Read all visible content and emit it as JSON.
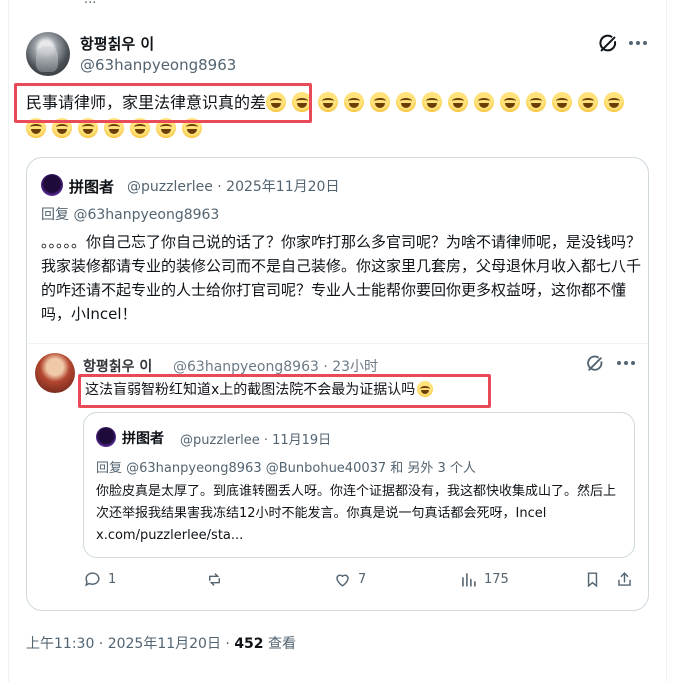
{
  "top_stub": "...",
  "author": {
    "name": "항평칡우 이",
    "handle": "@63hanpyeong8963"
  },
  "tweet": {
    "text": "民事请律师，家里法律意识真的差",
    "emoji_count_line1": 13,
    "emoji_count_line2": 8
  },
  "quote": {
    "name": "拼图者",
    "meta": "@puzzlerlee · 2025年11月20日",
    "reply_to": "回复 @63hanpyeong8963",
    "body": "。。。。。你自己忘了你自己说的话了？你家咋打那么多官司呢？为啥不请律师呢，是没钱吗？我家装修都请专业的装修公司而不是自己装修。你这家里几套房，父母退休月收入都七八千的咋还请不起专业的人士给你打官司呢？专业人士能帮你要回你更多权益呀，这你都不懂吗，小Incel！"
  },
  "reply": {
    "name": "항평칡우 이",
    "meta": "@63hanpyeong8963 · 23小时",
    "text": "这法盲弱智粉红知道x上的截图法院不会最为证据认吗"
  },
  "nested_quote": {
    "name": "拼图者",
    "meta": "@puzzlerlee · 11月19日",
    "reply_to": "回复 @63hanpyeong8963 @Bunbohue40037 和 另外 3 个人",
    "body": "你脸皮真是太厚了。到底谁转圈丢人呀。你连个证据都没有，我这都快收集成山了。然后上次还举报我结果害我冻结12小时不能发言。你真是说一句真话都会死呀，Incel x.com/puzzlerlee/sta..."
  },
  "actions": {
    "replies": "1",
    "retweets": "",
    "likes": "7",
    "views": "175"
  },
  "footer": {
    "time": "上午11:30 · 2025年11月20日 · ",
    "views_count": "452",
    "views_label": " 查看"
  },
  "colors": {
    "highlight_box": "#e84a57",
    "secondary_text": "#536471",
    "border": "#cfd9de"
  }
}
